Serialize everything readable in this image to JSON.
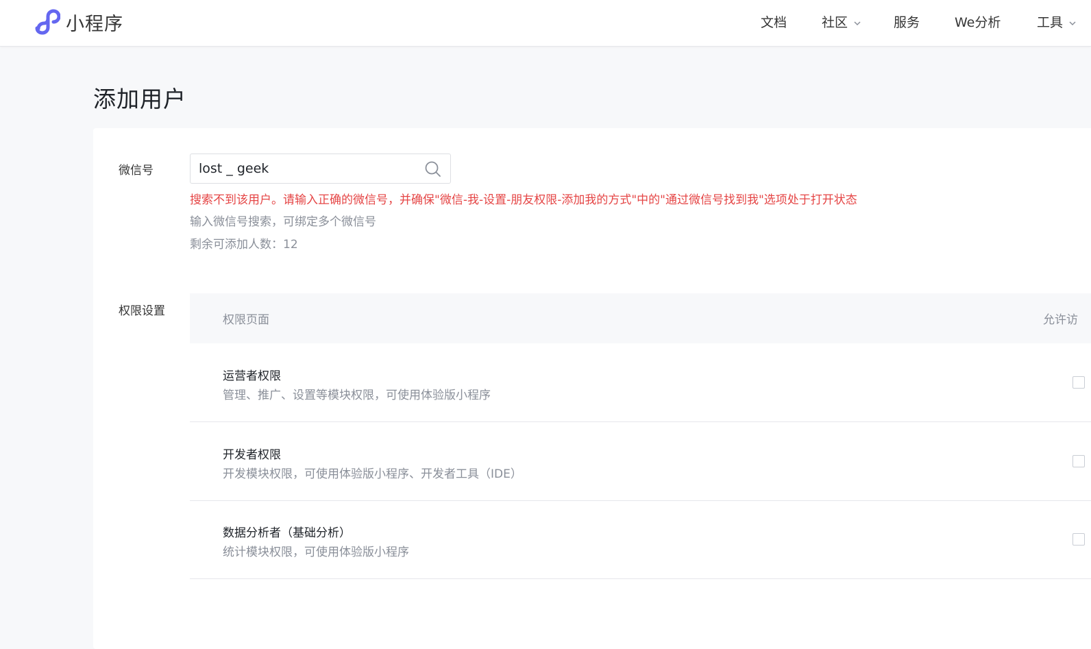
{
  "header": {
    "app_name": "小程序",
    "nav": [
      {
        "label": "文档",
        "has_dropdown": false
      },
      {
        "label": "社区",
        "has_dropdown": true
      },
      {
        "label": "服务",
        "has_dropdown": false
      },
      {
        "label": "We分析",
        "has_dropdown": false
      },
      {
        "label": "工具",
        "has_dropdown": true
      }
    ]
  },
  "page": {
    "title": "添加用户"
  },
  "wechat_field": {
    "label": "微信号",
    "value": "lost _ geek",
    "error": "搜索不到该用户。请输入正确的微信号，并确保\"微信-我-设置-朋友权限-添加我的方式\"中的\"通过微信号找到我\"选项处于打开状态",
    "hint": "输入微信号搜索，可绑定多个微信号",
    "remaining": "剩余可添加人数：12"
  },
  "permissions": {
    "label": "权限设置",
    "header_page": "权限页面",
    "header_allow": "允许访",
    "rows": [
      {
        "title": "运营者权限",
        "desc": "管理、推广、设置等模块权限，可使用体验版小程序"
      },
      {
        "title": "开发者权限",
        "desc": "开发模块权限，可使用体验版小程序、开发者工具（IDE）"
      },
      {
        "title": "数据分析者（基础分析）",
        "desc": "统计模块权限，可使用体验版小程序"
      }
    ]
  },
  "colors": {
    "brand": "#6467f0",
    "error": "#e54545",
    "muted": "#8a8f99"
  }
}
